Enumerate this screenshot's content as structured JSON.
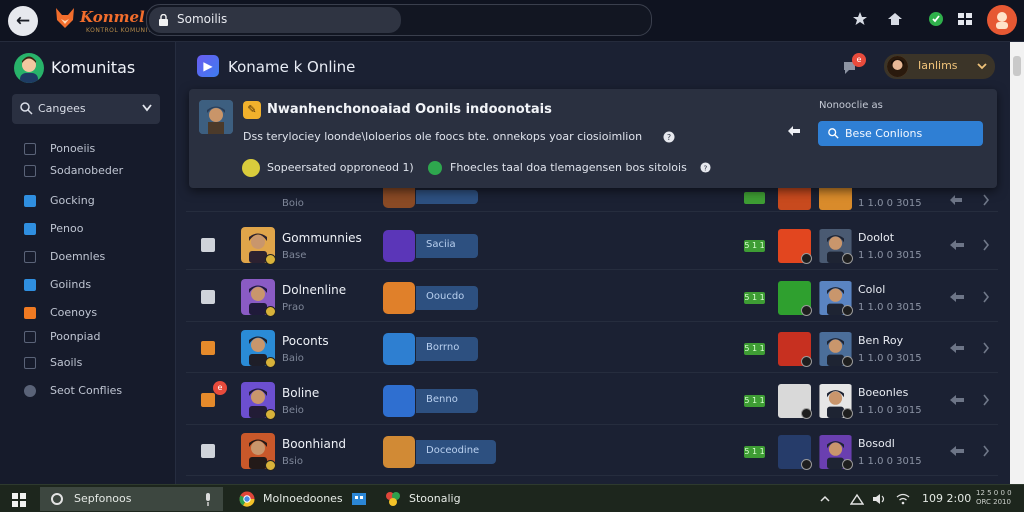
{
  "topbar": {
    "brand_name": "Konmel",
    "brand_tagline": "KONTROL KOMUNITAS",
    "address": "Somoilis",
    "icons": [
      "settings-icon",
      "home-icon",
      "extension-icon",
      "grid-icon",
      "profile-icon"
    ]
  },
  "sidebar": {
    "title": "Komunitas",
    "dropdown_label": "Cangees",
    "items": [
      {
        "label": "Ponoeiis",
        "icon": "outline-square-icon",
        "color": "#5a6378"
      },
      {
        "label": "Sodanobeder",
        "icon": "outline-square-icon",
        "color": "#5a6378"
      },
      {
        "label": "Gocking",
        "icon": "check-square-icon",
        "color": "#2f8fe0"
      },
      {
        "label": "Penoo",
        "icon": "check-square-icon",
        "color": "#2f8fe0"
      },
      {
        "label": "Doemnles",
        "icon": "outline-square-icon",
        "color": "#5a6378"
      },
      {
        "label": "Goiinds",
        "icon": "check-square-icon",
        "color": "#2f8fe0"
      },
      {
        "label": "Coenoys",
        "icon": "orange-square-icon",
        "color": "#f07a22"
      },
      {
        "label": "Poonpiad",
        "icon": "outline-square-icon",
        "color": "#5a6378"
      },
      {
        "label": "Saoils",
        "icon": "outline-square-icon",
        "color": "#5a6378"
      },
      {
        "label": "Seot Conflies",
        "icon": "circle-icon",
        "color": "#5a6378"
      }
    ]
  },
  "main": {
    "title": "Koname k Online",
    "notify_badge": "e",
    "user_name": "Ianlims"
  },
  "notice": {
    "title": "Nwanhenchonoaiad Oonils indoonotais",
    "body": "Dss terylociey loonde\\loloerios ole foocs bte. onnekops yoar ciosioimlion",
    "line2": "Sopeersated opproneod 1)",
    "line3": "Fhoecles taal doa tlemagensen bos sitolois",
    "side_label": "Nonooclie as",
    "button_label": "Bese Conlions"
  },
  "rows_partial": {
    "sub": "Boio",
    "time": "1 1.0 0 3015"
  },
  "rows": [
    {
      "name": "Gommunnies",
      "sub": "Base",
      "pill": "Saciia",
      "score": "5 1 1",
      "rname": "Doolot",
      "time": "1 1.0 0 3015",
      "checkbox": "#cfd3da",
      "badge": ""
    },
    {
      "name": "Dolnenline",
      "sub": "Prao",
      "pill": "Ooucdo",
      "score": "5 1 1",
      "rname": "Colol",
      "time": "1 1.0 0 3015",
      "checkbox": "#cfd3da",
      "badge": ""
    },
    {
      "name": "Poconts",
      "sub": "Baio",
      "pill": "Borrno",
      "score": "5 1 1",
      "rname": "Ben Roy",
      "time": "1 1.0 0 3015",
      "checkbox": "#e58a2b",
      "badge": ""
    },
    {
      "name": "Boline",
      "sub": "Beio",
      "pill": "Benno",
      "score": "5 1 1",
      "rname": "Boeonles",
      "time": "1 1.0 0 3015",
      "checkbox": "#e58a2b",
      "badge": "e"
    },
    {
      "name": "Boonhiand",
      "sub": "Bsio",
      "pill": "Doceodine",
      "score": "5 1 1",
      "rname": "Bosodl",
      "time": "1 1.0 0 3015",
      "checkbox": "#cfd3da",
      "badge": ""
    }
  ],
  "taskbar": {
    "search_text": "Sepfonoos",
    "app1": "Molnoedoones",
    "app2": "Stoonalig",
    "time": "109 2:00",
    "tray_label": "12 5 0 0 0\nORC 2010"
  },
  "colors": {
    "accent": "#2f7fd4",
    "brand": "#f26d2c",
    "background": "#1b2133"
  }
}
